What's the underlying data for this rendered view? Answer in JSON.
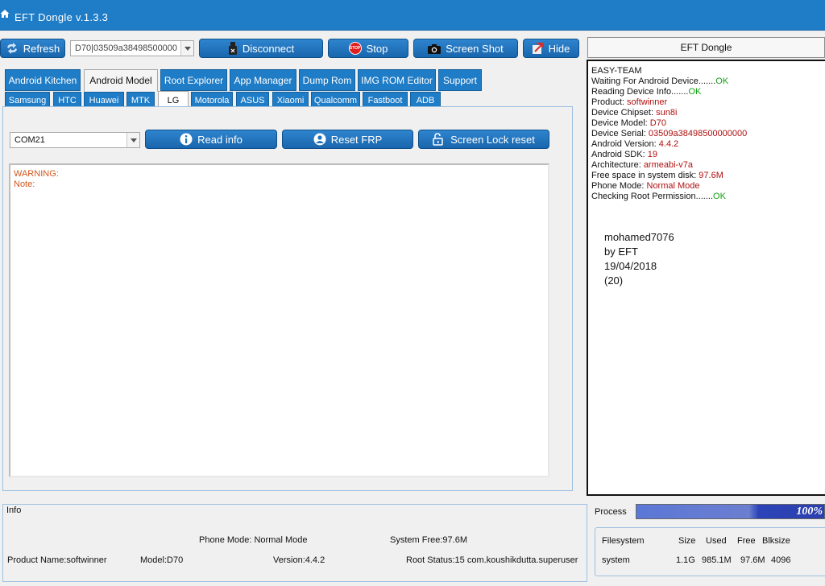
{
  "titlebar": {
    "title": "EFT Dongle  v.1.3.3"
  },
  "toolbar": {
    "refresh": "Refresh",
    "device_select": "D70|03509a38498500000",
    "disconnect": "Disconnect",
    "stop": "Stop",
    "stop_icon_text": "STOP",
    "screenshot": "Screen Shot",
    "hide": "Hide"
  },
  "tabs": [
    "Android Kitchen",
    "Android Model",
    "Root Explorer",
    "App Manager",
    "Dump Rom",
    "IMG ROM Editor",
    "Support"
  ],
  "brand_tabs": [
    "Samsung",
    "HTC",
    "Huawei",
    "MTK",
    "LG",
    "Motorola",
    "ASUS",
    "Xiaomi",
    "Qualcomm",
    "Fastboot",
    "ADB"
  ],
  "lg_panel": {
    "com_port": "COM21",
    "read_info": "Read info",
    "reset_frp": "Reset FRP",
    "screen_lock": "Screen Lock reset",
    "log_lines": [
      "WARNING:",
      "Note:"
    ]
  },
  "right_panel": {
    "header": "EFT Dongle",
    "team": "EASY-TEAM",
    "waiting": {
      "text": "Waiting For Android Device.......",
      "status": "OK"
    },
    "reading": {
      "text": "Reading Device Info.......",
      "status": "OK"
    },
    "product": {
      "label": "Product: ",
      "value": "softwinner"
    },
    "chipset": {
      "label": "Device Chipset: ",
      "value": "sun8i"
    },
    "model": {
      "label": "Device Model: ",
      "value": "D70"
    },
    "serial": {
      "label": "Device Serial: ",
      "value": "03509a38498500000000"
    },
    "android_version": {
      "label": "Android Version: ",
      "value": "4.4.2"
    },
    "sdk": {
      "label": "Android SDK: ",
      "value": "19"
    },
    "arch": {
      "label": "Architecture: ",
      "value": "armeabi-v7a"
    },
    "free_space": {
      "label": "Free space in system disk: ",
      "value": "97.6M"
    },
    "phone_mode": {
      "label": "Phone Mode: ",
      "value": "Normal Mode"
    },
    "root_check": {
      "text": "Checking Root Permission.......",
      "status": "OK"
    },
    "signature": [
      "mohamed7076",
      "by EFT",
      "19/04/2018",
      "(20)"
    ]
  },
  "info": {
    "label": "Info",
    "phone_mode": "Phone Mode: Normal Mode",
    "system_free": "System Free:97.6M",
    "product_name": "Product Name:softwinner",
    "model": "Model:D70",
    "version": "Version:4.4.2",
    "root_status": "Root Status:15 com.koushikdutta.superuser"
  },
  "process": {
    "label": "Process",
    "progress_percent": 100,
    "progress_text": "100%"
  },
  "filesystem": {
    "headers": [
      "Filesystem",
      "Size",
      "Used",
      "Free",
      "Blksize"
    ],
    "row": [
      "system",
      "1.1G",
      "985.1M",
      "97.6M",
      "4096"
    ]
  },
  "colors": {
    "titlebar": "#1f7cc6",
    "button": "#1f74bd",
    "ok": "#13a013",
    "value_red": "#b01010",
    "warning": "#d2551c"
  }
}
